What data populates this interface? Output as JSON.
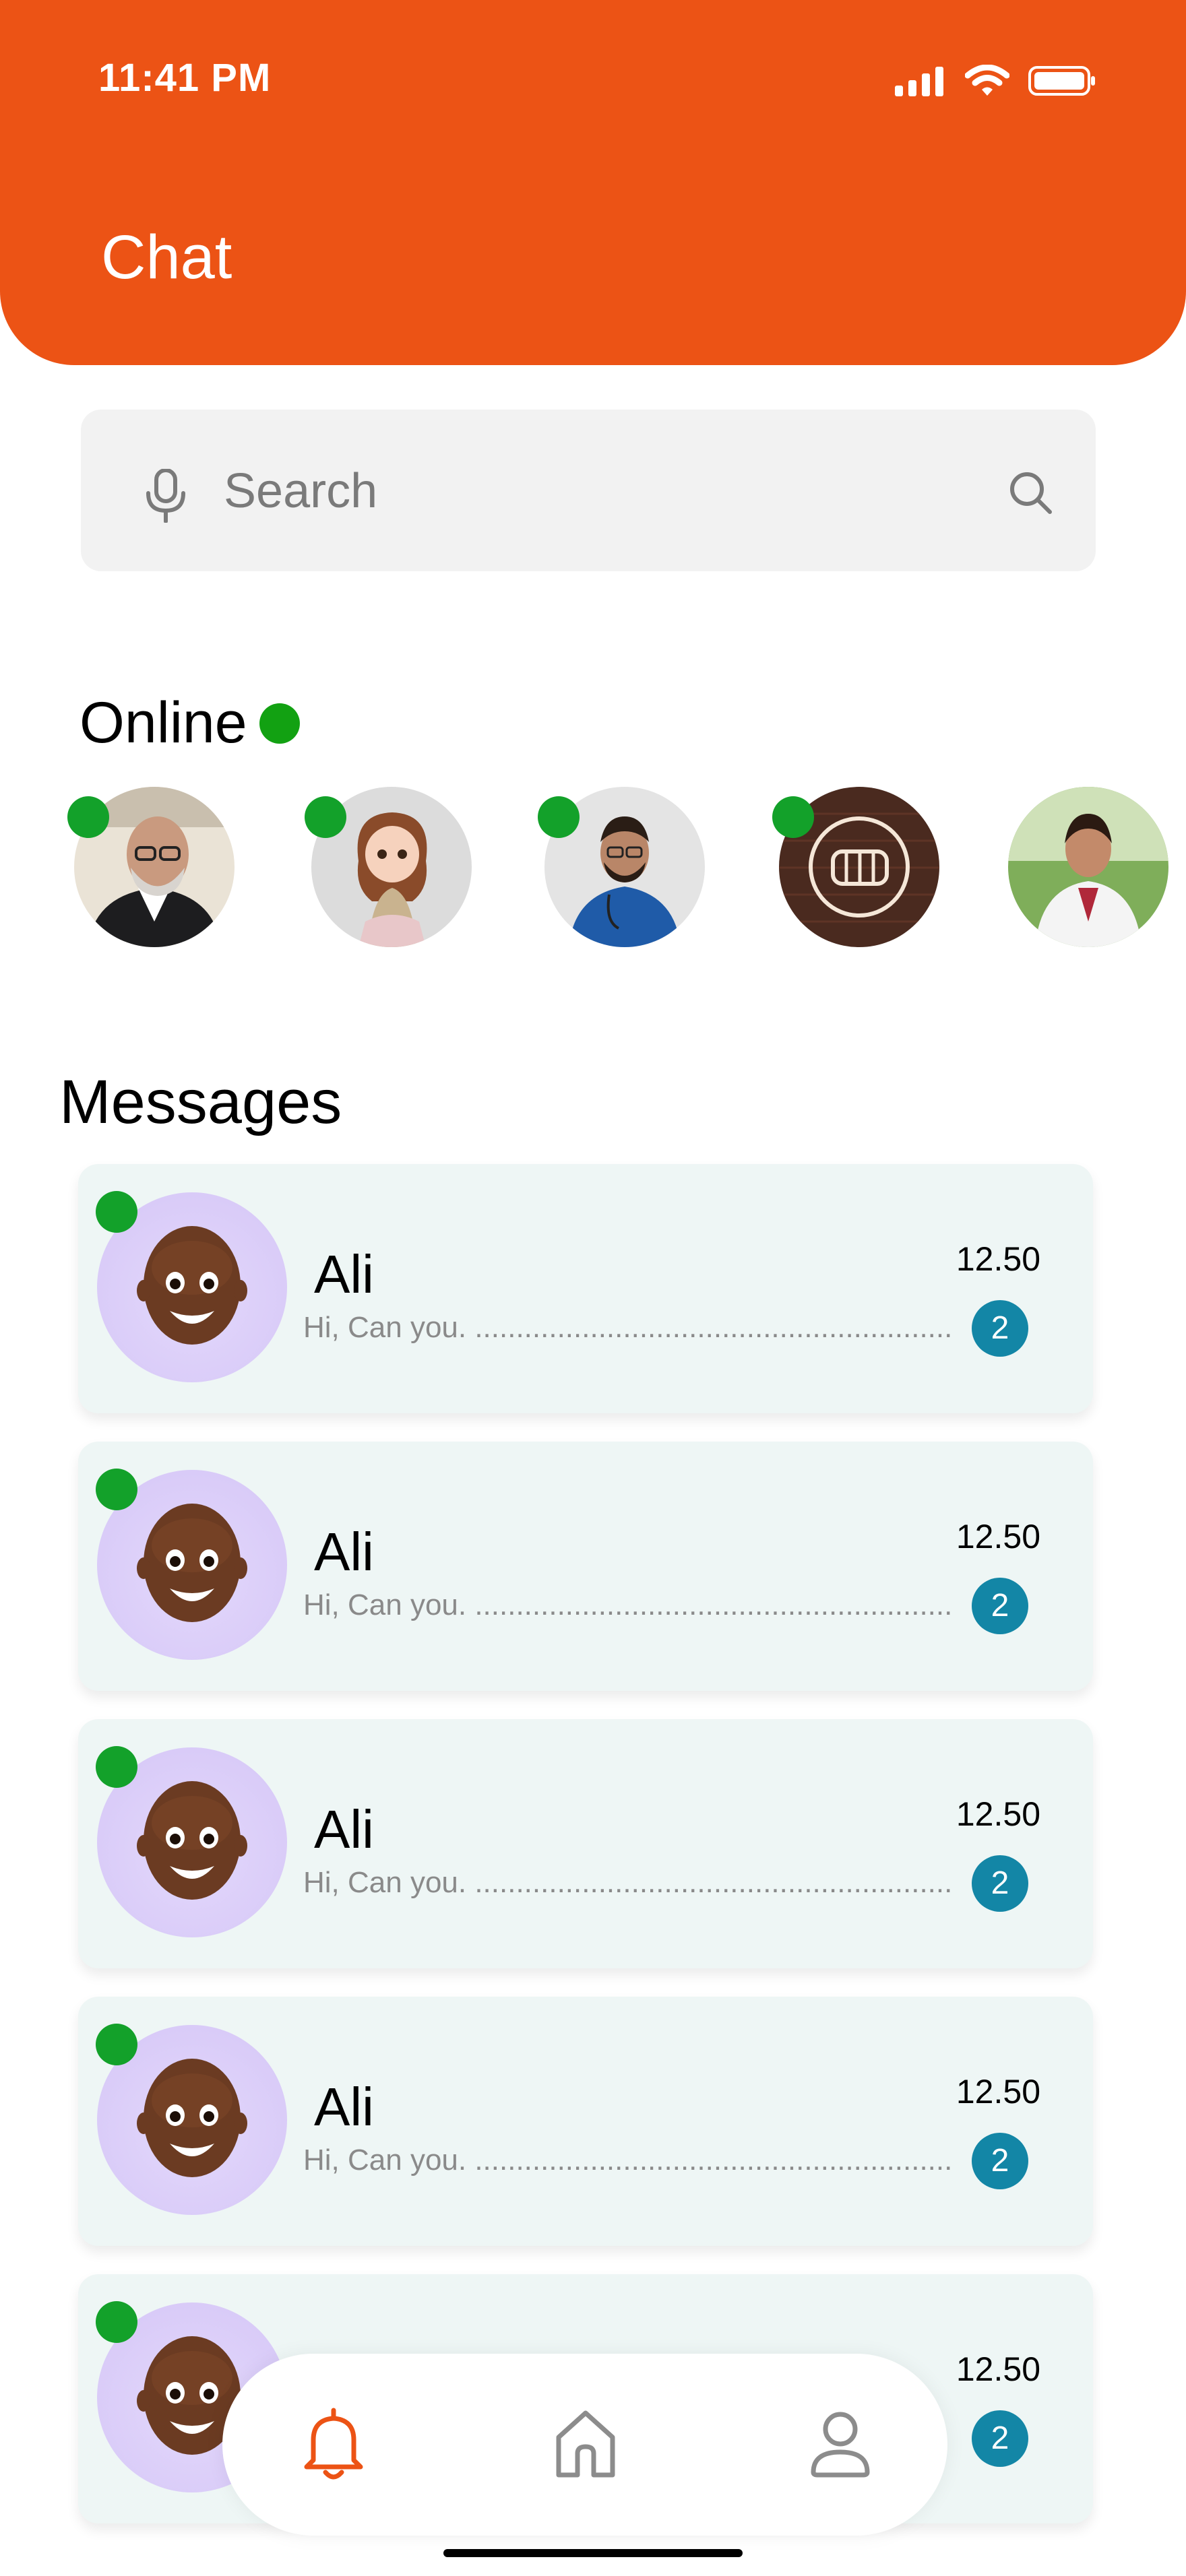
{
  "status_bar": {
    "time": "11:41 PM"
  },
  "header": {
    "title": "Chat"
  },
  "search": {
    "placeholder": "Search"
  },
  "online": {
    "title": "Online",
    "users": [
      {
        "avatar": "man-glasses-photo"
      },
      {
        "avatar": "cartoon-girl-illustration"
      },
      {
        "avatar": "doctor-man-photo"
      },
      {
        "avatar": "neon-fist-logo"
      },
      {
        "avatar": "doctor-woman-photo"
      }
    ]
  },
  "messages": {
    "title": "Messages",
    "items": [
      {
        "name": "Ali",
        "preview": "Hi, Can you. ..........................................................",
        "time": "12.50",
        "unread": "2"
      },
      {
        "name": "Ali",
        "preview": "Hi, Can you. ..........................................................",
        "time": "12.50",
        "unread": "2"
      },
      {
        "name": "Ali",
        "preview": "Hi, Can you. ..........................................................",
        "time": "12.50",
        "unread": "2"
      },
      {
        "name": "Ali",
        "preview": "Hi, Can you. ..........................................................",
        "time": "12.50",
        "unread": "2"
      },
      {
        "name": "",
        "preview": "",
        "time": "12.50",
        "unread": "2"
      }
    ]
  },
  "bottom_nav": {
    "items": [
      {
        "icon": "bell-icon",
        "active": true
      },
      {
        "icon": "home-icon",
        "active": false
      },
      {
        "icon": "profile-icon",
        "active": false
      }
    ]
  },
  "colors": {
    "accent": "#ec5315",
    "online": "#13a12a",
    "badge": "#1386a6",
    "card": "#eef6f5"
  }
}
